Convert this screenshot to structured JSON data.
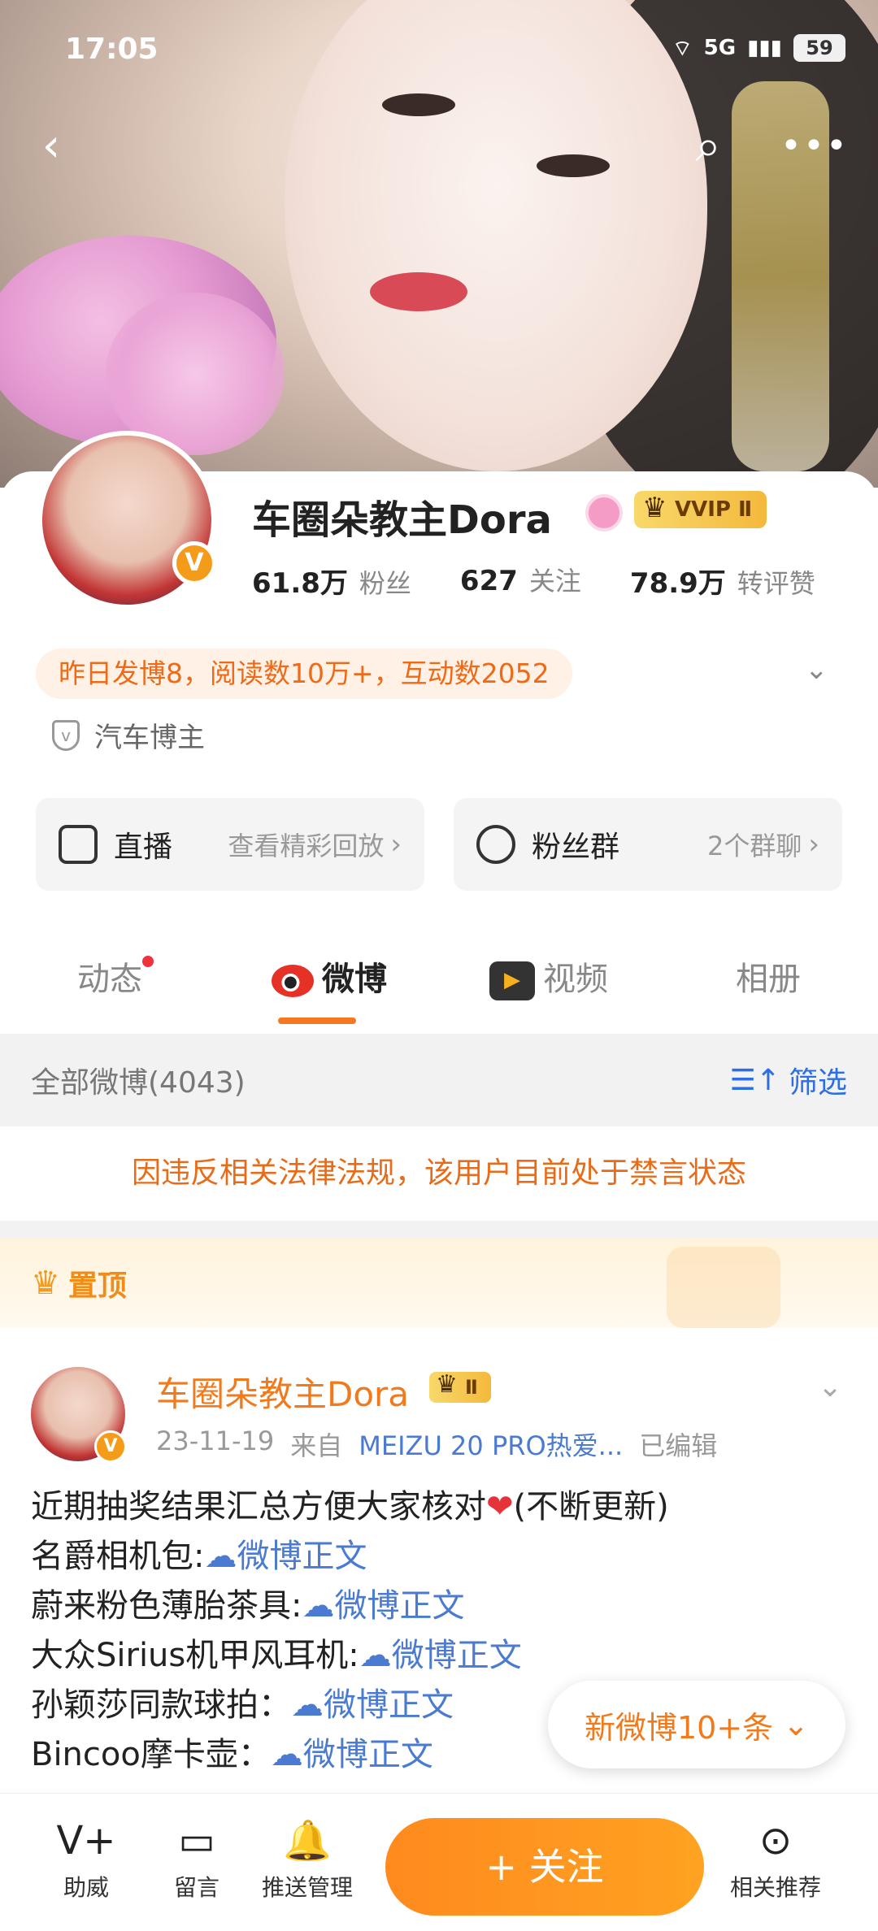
{
  "status": {
    "time": "17:05",
    "network": "5G",
    "battery": "59"
  },
  "profile": {
    "name": "车圈朵教主Dora",
    "vip_label": "VVIP Ⅱ",
    "stats": [
      {
        "value": "61.8万",
        "label": "粉丝"
      },
      {
        "value": "627",
        "label": "关注"
      },
      {
        "value": "78.9万",
        "label": "转评赞"
      }
    ],
    "activity": "昨日发博8，阅读数10万+，互动数2052",
    "category": "汽车博主",
    "cards": [
      {
        "title": "直播",
        "sub": "查看精彩回放"
      },
      {
        "title": "粉丝群",
        "sub": "2个群聊"
      }
    ]
  },
  "tabs": [
    {
      "label": "动态"
    },
    {
      "label": "微博"
    },
    {
      "label": "视频"
    },
    {
      "label": "相册"
    }
  ],
  "filter": {
    "all": "全部微博(4043)",
    "filter_label": "筛选"
  },
  "ban_notice": "因违反相关法律法规，该用户目前处于禁言状态",
  "pinned_label": "置顶",
  "post": {
    "author": "车圈朵教主Dora",
    "vip_label": "Ⅱ",
    "date": "23-11-19",
    "from_prefix": "来自",
    "source": "MEIZU 20 PRO热爱...",
    "edited": "已编辑",
    "line1_text": "近期抽奖结果汇总方便大家核对",
    "line1_suffix": "(不断更新)",
    "lines": [
      {
        "text": "名爵相机包:",
        "link": "微博正文"
      },
      {
        "text": "蔚来粉色薄胎茶具:",
        "link": "微博正文"
      },
      {
        "text": "大众Sirius机甲风耳机:",
        "link": "微博正文"
      },
      {
        "text": "孙颖莎同款球拍：",
        "link": "微博正文"
      },
      {
        "text": "Bincoo摩卡壶：",
        "link": "微博正文"
      }
    ]
  },
  "new_posts": "新微博10+条",
  "bottom": {
    "items": [
      {
        "label": "助威"
      },
      {
        "label": "留言"
      },
      {
        "label": "推送管理"
      },
      {
        "label": "相关推荐"
      }
    ],
    "follow": "+ 关注"
  }
}
